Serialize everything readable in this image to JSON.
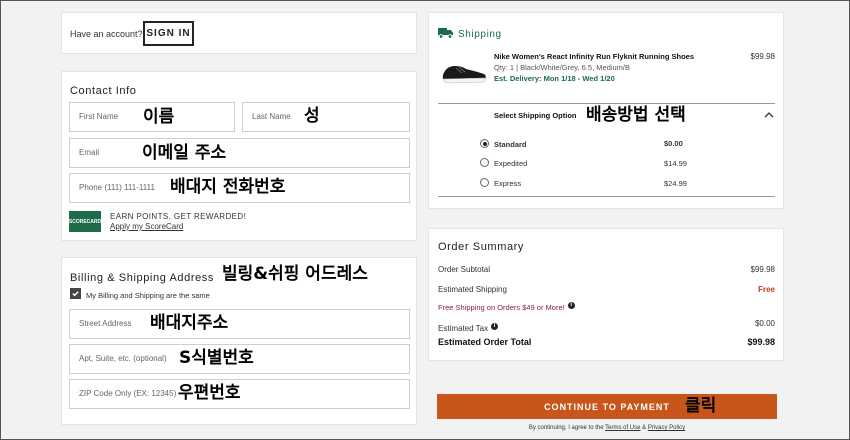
{
  "account": {
    "prompt": "Have an account?",
    "sign_in": "SIGN IN"
  },
  "contact": {
    "title": "Contact Info",
    "first_name": {
      "placeholder": "First Name",
      "note": "이름"
    },
    "last_name": {
      "placeholder": "Last Name",
      "note": "성"
    },
    "email": {
      "placeholder": "Email",
      "note": "이메일 주소"
    },
    "phone": {
      "placeholder": "Phone (111) 111-1111",
      "note": "배대지 전화번호"
    },
    "scorecard": {
      "badge": "SCORECARD",
      "headline": "EARN POINTS. GET REWARDED!",
      "link": "Apply my ScoreCard"
    }
  },
  "billing": {
    "title": "Billing & Shipping Address",
    "title_note": "빌링&쉬핑 어드레스",
    "same_label": "My Billing and Shipping are the same",
    "street": {
      "placeholder": "Street Address",
      "note": "배대지주소"
    },
    "apt": {
      "placeholder": "Apt, Suite, etc. (optional)",
      "note": "S식별번호"
    },
    "zip": {
      "placeholder": "ZIP Code Only (EX: 12345)",
      "note": "우편번호"
    }
  },
  "shipping": {
    "title": "Shipping",
    "product": {
      "name": "Nike Women's React Infinity Run Flyknit Running Shoes",
      "meta": "Qty: 1 | Black/White/Grey, 6.5, Medium/B",
      "delivery": "Est. Delivery: Mon 1/18 - Wed 1/20",
      "price": "$99.98"
    },
    "option_header": "Select Shipping Option",
    "option_note": "배송방법 선택",
    "options": [
      {
        "label": "Standard",
        "price": "$0.00",
        "selected": true
      },
      {
        "label": "Expedited",
        "price": "$14.99",
        "selected": false
      },
      {
        "label": "Express",
        "price": "$24.99",
        "selected": false
      }
    ]
  },
  "summary": {
    "title": "Order Summary",
    "subtotal_label": "Order Subtotal",
    "subtotal_value": "$99.98",
    "shipping_label": "Estimated Shipping",
    "shipping_value": "Free",
    "free_note": "Free Shipping on Orders $49 or More!",
    "tax_label": "Estimated Tax",
    "tax_value": "$0.00",
    "total_label": "Estimated Order Total",
    "total_value": "$99.98"
  },
  "checkout": {
    "button": "CONTINUE TO PAYMENT",
    "button_note": "클릭",
    "terms_prefix": "By continuing, I agree to the ",
    "terms_link": "Terms of Use",
    "terms_and": " & ",
    "privacy_link": "Privacy Policy"
  },
  "colors": {
    "accent_green": "#1d6b48",
    "cta_orange": "#c8561b",
    "free_red": "#c0392b",
    "promo_maroon": "#8b1e3f"
  },
  "icons": {
    "truck": "truck-icon",
    "chevron": "chevron-up-icon",
    "check": "checkmark-icon",
    "info": "info-icon"
  }
}
